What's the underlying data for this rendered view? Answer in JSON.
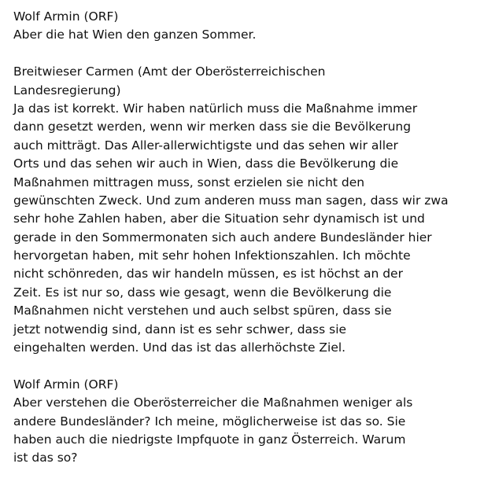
{
  "blocks": [
    {
      "speaker": "Wolf Armin (ORF)",
      "lines": [
        "Aber die hat Wien den ganzen Sommer."
      ]
    },
    {
      "speaker_lines": [
        "Breitwieser Carmen (Amt der Oberösterreichischen",
        "Landesregierung)"
      ],
      "lines": [
        "Ja das ist korrekt. Wir haben natürlich muss die Maßnahme immer",
        "dann gesetzt werden, wenn wir merken dass sie die Bevölkerung",
        "auch mitträgt. Das Aller-allerwichtigste und das sehen wir aller",
        "Orts und das sehen wir auch in Wien, dass die Bevölkerung die",
        "Maßnahmen mittragen muss, sonst erzielen sie nicht den",
        "gewünschten Zweck. Und zum anderen muss man sagen, dass wir zwa",
        "sehr hohe Zahlen haben, aber die Situation sehr dynamisch ist und",
        "gerade in den Sommermonaten sich auch andere Bundesländer hier",
        "hervorgetan haben, mit sehr hohen Infektionszahlen. Ich möchte",
        "nicht schönreden, das wir handeln müssen, es ist höchst an der",
        "Zeit. Es ist nur so, dass wie gesagt, wenn die Bevölkerung die",
        "Maßnahmen nicht verstehen und auch selbst spüren, dass sie",
        "jetzt notwendig sind, dann ist es sehr schwer, dass sie",
        "eingehalten werden. Und das ist das allerhöchste Ziel."
      ]
    },
    {
      "speaker": "Wolf Armin (ORF)",
      "lines": [
        "Aber verstehen die Oberösterreicher die Maßnahmen weniger als",
        "andere Bundesländer? Ich meine, möglicherweise ist das so. Sie",
        "haben auch die niedrigste Impfquote in ganz Österreich. Warum",
        "ist das so?"
      ]
    }
  ]
}
